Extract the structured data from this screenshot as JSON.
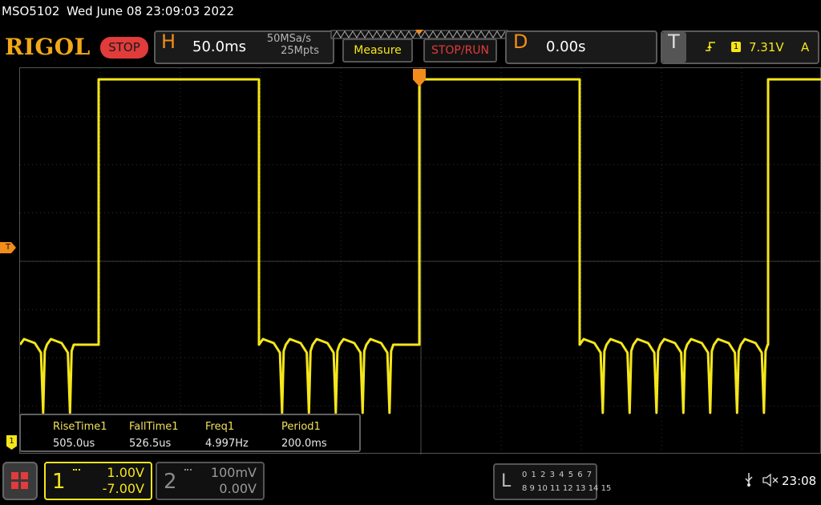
{
  "header": {
    "model": "MSO5102",
    "datetime": "Wed June 08 23:09:03 2022"
  },
  "toolbar": {
    "brand": "RIGOL",
    "run_state": "STOP",
    "horizontal_letter": "H",
    "timebase": "50.0ms",
    "sample_rate": "50MSa/s",
    "memory_depth": "25Mpts",
    "measure_label": "Measure",
    "stoprun_label": "STOP/RUN",
    "delay_letter": "D",
    "delay": "0.00s",
    "trigger_letter": "T",
    "trigger_source": "1",
    "trigger_level": "7.31V",
    "trigger_mode": "A"
  },
  "markers": {
    "trigger_level_marker": "T",
    "ch1_ground_marker": "1"
  },
  "measurements": {
    "labels": [
      "RiseTime1",
      "FallTime1",
      "Freq1",
      "Period1"
    ],
    "values": [
      "505.0us",
      "526.5us",
      "4.997Hz",
      "200.0ms"
    ]
  },
  "channels": {
    "ch1": {
      "number": "1",
      "scale": "1.00V",
      "offset": "-7.00V"
    },
    "ch2": {
      "number": "2",
      "scale": "100mV",
      "offset": "0.00V"
    }
  },
  "logic": {
    "letter": "L",
    "row1": "0 1 2 3   4 5 6 7",
    "row2": "8 9 10 11 12 13 14 15"
  },
  "status": {
    "time": "23:08"
  },
  "colors": {
    "ch1": "#f5e61a",
    "accent": "#f28c1a",
    "stop": "#e23b3b",
    "grid": "#5a5a5a"
  }
}
